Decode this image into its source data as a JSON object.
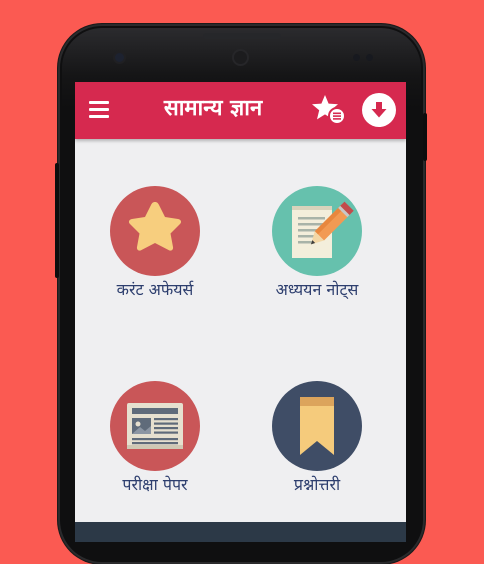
{
  "app": {
    "title": "सामान्य ज्ञान"
  },
  "toolbar": {
    "menu_icon": "hamburger-menu-icon",
    "favorites_icon": "star-list-icon",
    "download_icon": "download-arrow-icon"
  },
  "tiles": [
    {
      "label": "करंट अफेयर्स",
      "icon": "star-icon",
      "color": "#c95658"
    },
    {
      "label": "अध्ययन नोट्स",
      "icon": "notepad-pencil-icon",
      "color": "#66c1ad"
    },
    {
      "label": "परीक्षा पेपर",
      "icon": "newspaper-icon",
      "color": "#c95658"
    },
    {
      "label": "प्रश्नोत्तरी",
      "icon": "bookmark-icon",
      "color": "#3f4d66"
    }
  ],
  "colors": {
    "background": "#fb5a52",
    "app_bar": "#d6294f",
    "screen": "#efeff1",
    "label_text": "#2d3e6e"
  }
}
